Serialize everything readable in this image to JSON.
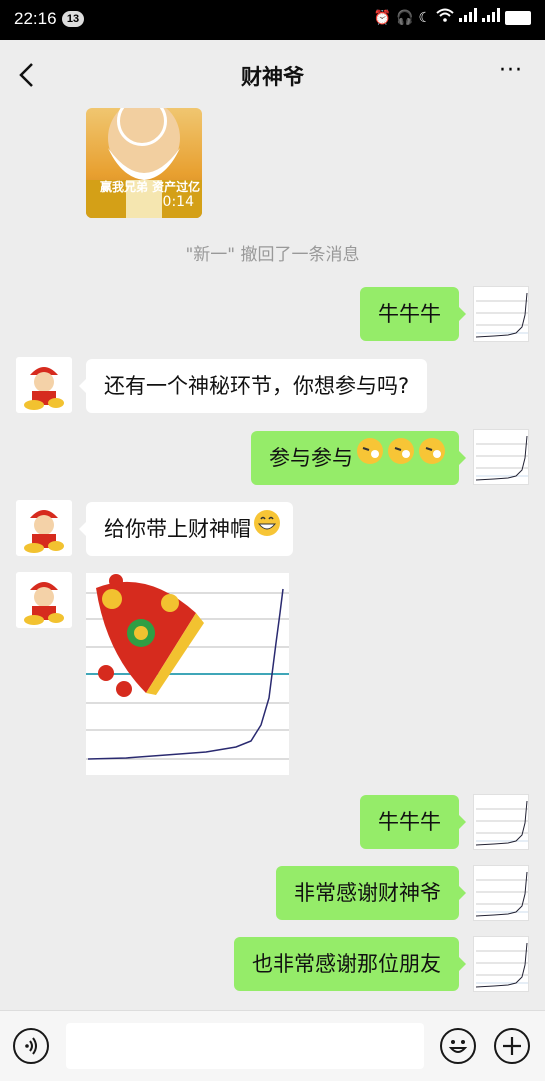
{
  "status_bar": {
    "time": "22:16",
    "badge": "13"
  },
  "header": {
    "title": "财神爷",
    "more": "···"
  },
  "video": {
    "caption": "赢我兄弟  资产过亿",
    "duration": "0:14"
  },
  "recall_notice": "\"新一\" 撤回了一条消息",
  "messages": [
    {
      "side": "right",
      "text": "牛牛牛"
    },
    {
      "side": "left",
      "text": "还有一个神秘环节，你想参与吗?"
    },
    {
      "side": "right",
      "text": "参与参与"
    },
    {
      "side": "left",
      "text": "给你带上财神帽"
    },
    {
      "side": "left",
      "type": "sticker"
    },
    {
      "side": "right",
      "text": "牛牛牛"
    },
    {
      "side": "right",
      "text": "非常感谢财神爷"
    },
    {
      "side": "right",
      "text": "也非常感谢那位朋友"
    }
  ],
  "icons": [
    "back-arrow-icon",
    "more-icon",
    "play-icon",
    "voice-icon",
    "emoji-icon",
    "plus-icon",
    "alarm-icon",
    "wifi-icon",
    "signal-icon",
    "battery-icon"
  ],
  "colors": {
    "right_bubble": "#95ec69",
    "left_bubble": "#ffffff",
    "background": "#ededed"
  }
}
